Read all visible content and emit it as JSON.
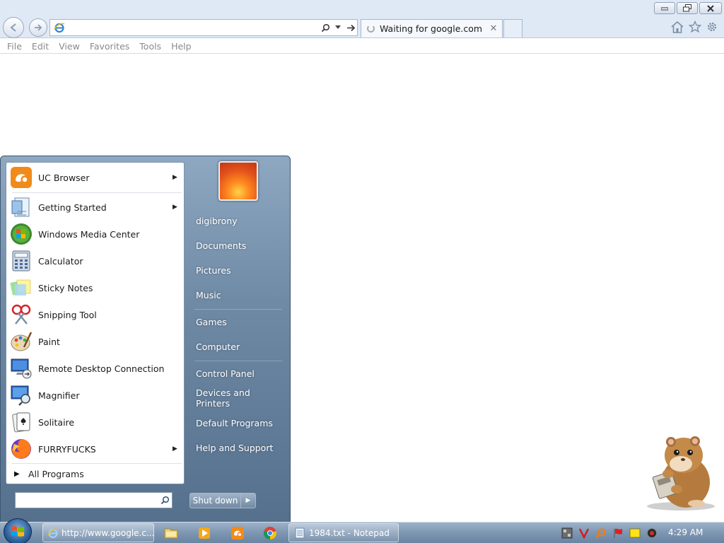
{
  "browser": {
    "address_value": "",
    "tab_title": "Waiting for google.com",
    "menu": [
      "File",
      "Edit",
      "View",
      "Favorites",
      "Tools",
      "Help"
    ]
  },
  "start_menu": {
    "programs": [
      {
        "label": "UC Browser",
        "icon": "uc-browser-icon",
        "submenu": true
      },
      {
        "label": "Getting Started",
        "icon": "getting-started-icon",
        "submenu": true
      },
      {
        "label": "Windows Media Center",
        "icon": "windows-media-center-icon",
        "submenu": false
      },
      {
        "label": "Calculator",
        "icon": "calculator-icon",
        "submenu": false
      },
      {
        "label": "Sticky Notes",
        "icon": "sticky-notes-icon",
        "submenu": false
      },
      {
        "label": "Snipping Tool",
        "icon": "snipping-tool-icon",
        "submenu": false
      },
      {
        "label": "Paint",
        "icon": "paint-icon",
        "submenu": false
      },
      {
        "label": "Remote Desktop Connection",
        "icon": "remote-desktop-icon",
        "submenu": false
      },
      {
        "label": "Magnifier",
        "icon": "magnifier-icon",
        "submenu": false
      },
      {
        "label": "Solitaire",
        "icon": "solitaire-icon",
        "submenu": false
      },
      {
        "label": "FURRYFUCKS",
        "icon": "firefox-icon",
        "submenu": true
      }
    ],
    "all_programs": "All Programs",
    "search_value": "",
    "places": [
      "digibrony",
      "Documents",
      "Pictures",
      "Music",
      "Games",
      "Computer",
      "Control Panel",
      "Devices and Printers",
      "Default Programs",
      "Help and Support"
    ],
    "shutdown_label": "Shut down"
  },
  "taskbar": {
    "ie_button": "http://www.google.c...",
    "notepad_button": "1984.txt - Notepad",
    "clock": "4:29 AM"
  },
  "colors": {
    "taskbar": "#7d96b2",
    "start_menu": "#6f8aa5",
    "ie_frame": "#dfe9f5"
  }
}
